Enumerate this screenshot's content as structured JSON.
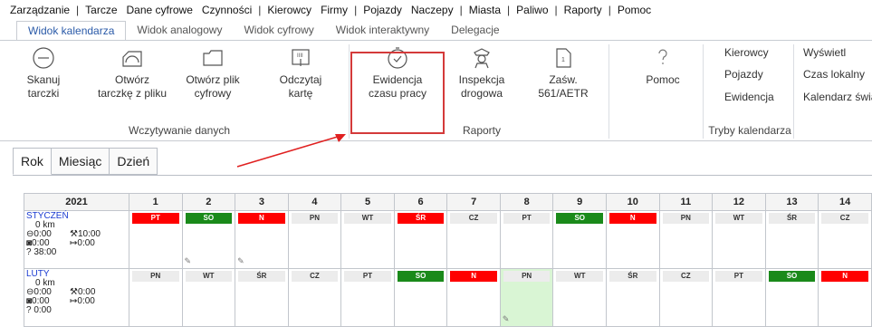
{
  "menubar": [
    "Zarządzanie",
    "|",
    "Tarcze",
    "Dane cyfrowe",
    "Czynności",
    "|",
    "Kierowcy",
    "Firmy",
    "|",
    "Pojazdy",
    "Naczepy",
    "|",
    "Miasta",
    "|",
    "Paliwo",
    "|",
    "Raporty",
    "|",
    "Pomoc"
  ],
  "ribbon_tabs": [
    "Widok kalendarza",
    "Widok analogowy",
    "Widok cyfrowy",
    "Widok interaktywny",
    "Delegacje"
  ],
  "ribbon": {
    "skanuj": "Skanuj\ntarczki",
    "otworz_tarcze": "Otwórz\ntarczkę z pliku",
    "otworz_plik": "Otwórz plik\ncyfrowy",
    "odczytaj": "Odczytaj\nkartę",
    "ewidencja": "Ewidencja\nczasu pracy",
    "inspekcja": "Inspekcja\ndrogowa",
    "zasw": "Zaśw.\n561/AETR",
    "pomoc": "Pomoc",
    "group_wczytywanie": "Wczytywanie danych",
    "group_raporty": "Raporty",
    "group_tryby": "Tryby kalendarza",
    "link_kierowcy": "Kierowcy",
    "link_pojazdy": "Pojazdy",
    "link_ewidencja": "Ewidencja",
    "link_wyswietl": "Wyświetl",
    "link_czas": "Czas lokalny",
    "link_kalendarz": "Kalendarz świa"
  },
  "view_tabs": [
    "Rok",
    "Miesiąc",
    "Dzień"
  ],
  "calendar": {
    "year": "2021",
    "days": [
      "1",
      "2",
      "3",
      "4",
      "5",
      "6",
      "7",
      "8",
      "9",
      "10",
      "11",
      "12",
      "13",
      "14"
    ],
    "months": [
      {
        "name": "STYCZEŃ",
        "km": "0 km",
        "drive": "0:00",
        "work": "10:00",
        "avail": "0:00",
        "rest": "0:00",
        "other": "38:00",
        "badges": [
          {
            "t": "PT",
            "c": "red"
          },
          {
            "t": "SO",
            "c": "green"
          },
          {
            "t": "N",
            "c": "red"
          },
          {
            "t": "PN",
            "c": "plain"
          },
          {
            "t": "WT",
            "c": "plain"
          },
          {
            "t": "ŚR",
            "c": "red"
          },
          {
            "t": "CZ",
            "c": "plain"
          },
          {
            "t": "PT",
            "c": "plain"
          },
          {
            "t": "SO",
            "c": "green"
          },
          {
            "t": "N",
            "c": "red"
          },
          {
            "t": "PN",
            "c": "plain"
          },
          {
            "t": "WT",
            "c": "plain"
          },
          {
            "t": "ŚR",
            "c": "plain"
          },
          {
            "t": "CZ",
            "c": "plain"
          }
        ]
      },
      {
        "name": "LUTY",
        "km": "0 km",
        "drive": "0:00",
        "work": "0:00",
        "avail": "0:00",
        "rest": "0:00",
        "other": "0:00",
        "badges": [
          {
            "t": "PN",
            "c": "plain"
          },
          {
            "t": "WT",
            "c": "plain"
          },
          {
            "t": "ŚR",
            "c": "plain"
          },
          {
            "t": "CZ",
            "c": "plain"
          },
          {
            "t": "PT",
            "c": "plain"
          },
          {
            "t": "SO",
            "c": "green"
          },
          {
            "t": "N",
            "c": "red"
          },
          {
            "t": "PN",
            "c": "plain"
          },
          {
            "t": "WT",
            "c": "plain"
          },
          {
            "t": "ŚR",
            "c": "plain"
          },
          {
            "t": "CZ",
            "c": "plain"
          },
          {
            "t": "PT",
            "c": "plain"
          },
          {
            "t": "SO",
            "c": "green"
          },
          {
            "t": "N",
            "c": "red"
          }
        ]
      }
    ]
  },
  "colors": {
    "highlight": "#d43a3a",
    "accent": "#2a5aa8",
    "weekend_red": "#ff0000",
    "weekend_green": "#1a8a1a"
  }
}
